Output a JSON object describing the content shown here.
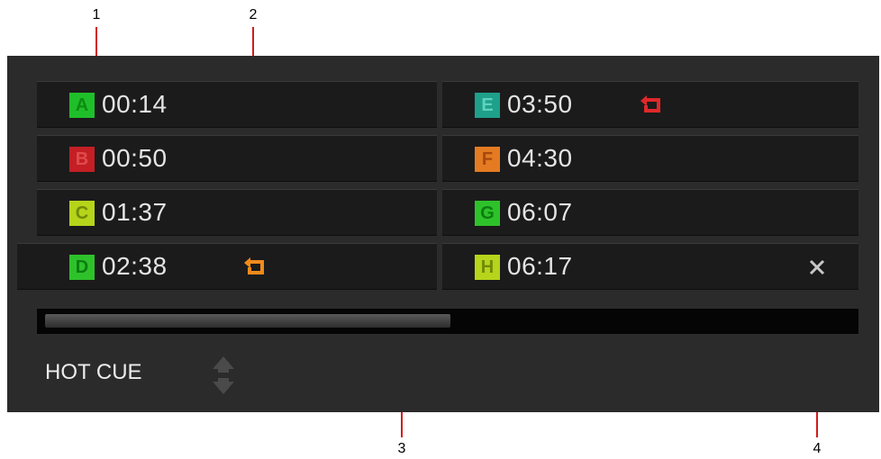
{
  "callouts": [
    "1",
    "2",
    "3",
    "4"
  ],
  "colors": {
    "callout_line": "#d11c1c",
    "panel_bg": "#2b2b2b",
    "row_bg": "#1b1b1b",
    "loop_red": "#e0282a",
    "loop_orange": "#f08a1c"
  },
  "hot_cues": {
    "left": [
      {
        "letter": "A",
        "time": "00:14",
        "color": "#1fbf2a",
        "text_color": "#0e8c12",
        "loop": false
      },
      {
        "letter": "B",
        "time": "00:50",
        "color": "#c41f25",
        "text_color": "#e04b4b",
        "loop": false
      },
      {
        "letter": "C",
        "time": "01:37",
        "color": "#b6d41a",
        "text_color": "#6f8a08",
        "loop": false
      },
      {
        "letter": "D",
        "time": "02:38",
        "color": "#2ec22a",
        "text_color": "#0c7d10",
        "loop": true,
        "loop_color": "orange"
      }
    ],
    "right": [
      {
        "letter": "E",
        "time": "03:50",
        "color": "#1fa08a",
        "text_color": "#5fd2bd",
        "loop": true,
        "loop_color": "red"
      },
      {
        "letter": "F",
        "time": "04:30",
        "color": "#e47b22",
        "text_color": "#a7480e",
        "loop": false
      },
      {
        "letter": "G",
        "time": "06:07",
        "color": "#2ec22a",
        "text_color": "#0c7d10",
        "loop": false
      },
      {
        "letter": "H",
        "time": "06:17",
        "color": "#b6d41a",
        "text_color": "#6f8a08",
        "loop": false,
        "delete_icon": "close-icon"
      }
    ]
  },
  "icons": {
    "loop": "loop-icon",
    "delete": "close-icon",
    "mode_stepper": "up-down-arrows-icon"
  },
  "scroll": {
    "position_fraction": 0.5
  },
  "mode": {
    "label": "HOT CUE"
  }
}
